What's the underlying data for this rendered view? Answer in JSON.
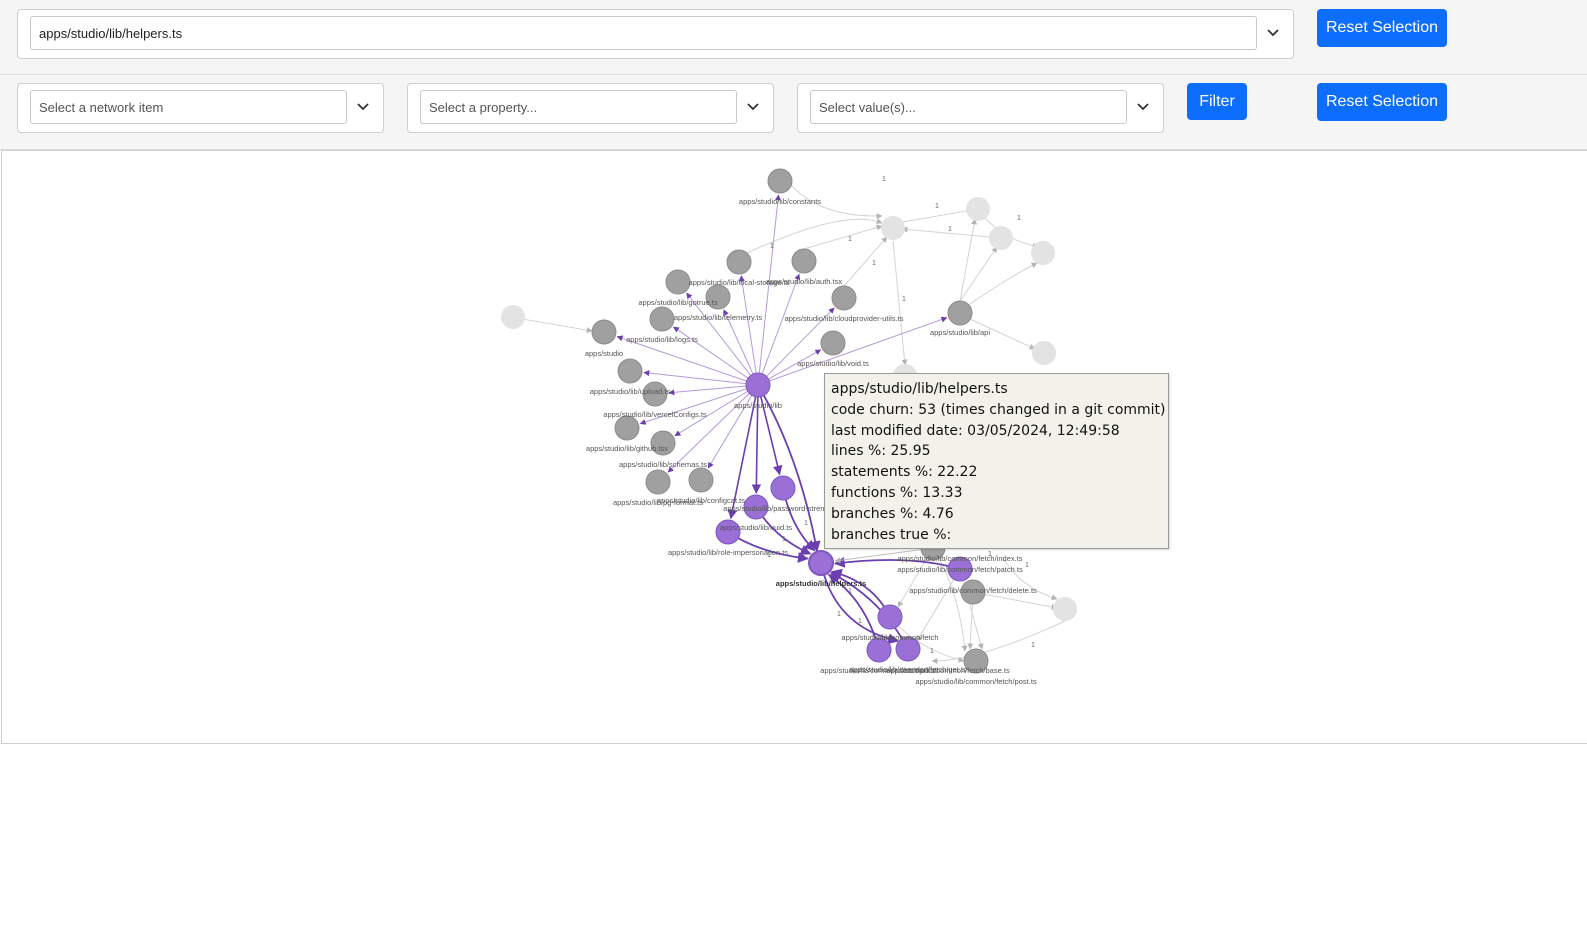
{
  "top_bar": {
    "file_select_value": "apps/studio/lib/helpers.ts",
    "reset_label": "Reset Selection"
  },
  "filter_bar": {
    "network_placeholder": "Select a network item",
    "property_placeholder": "Select a property...",
    "values_placeholder": "Select value(s)...",
    "filter_label": "Filter",
    "reset_label": "Reset Selection"
  },
  "colors": {
    "primary": "#0d6efd",
    "selected_node": "#9a6fd6",
    "neighbor_node": "#a0a0a0",
    "faded_node": "#e3e3e3",
    "selected_edge": "#6b3fb0"
  },
  "graph": {
    "nodes": [
      {
        "label": "apps/studio/lib/constants"
      },
      {
        "label": "apps/studio/lib/local-storage.ts"
      },
      {
        "label": "apps/studio/lib/auth.tsx"
      },
      {
        "label": "apps/studio/lib/gotrue.ts"
      },
      {
        "label": "apps/studio/lib/telemetry.ts"
      },
      {
        "label": "apps/studio/lib/cloudprovider-utils.ts"
      },
      {
        "label": "apps/studio/lib/logs.ts"
      },
      {
        "label": "apps/studio"
      },
      {
        "label": "apps/studio/lib/api"
      },
      {
        "label": "apps/studio/lib/void.ts"
      },
      {
        "label": "apps/studio/lib/upload.ts"
      },
      {
        "label": "apps/studio/lib"
      },
      {
        "label": "apps/studio/lib/vercelConfigs.ts"
      },
      {
        "label": "apps/studio/lib/github.tsx"
      },
      {
        "label": "apps/studio/lib/schemas.ts"
      },
      {
        "label": "apps/studio/lib/pg-format.ts"
      },
      {
        "label": "apps/studio/lib/configcat.ts"
      },
      {
        "label": "apps/studio/lib/password-strength.ts"
      },
      {
        "label": "apps/studio/lib/uuid.ts"
      },
      {
        "label": "apps/studio/lib/role-impersonation.ts"
      },
      {
        "label": "apps/studio/lib/helpers.ts"
      },
      {
        "label": "apps/studio/lib/common/fetch/index.ts"
      },
      {
        "label": "apps/studio/lib/common/fetch/patch.ts"
      },
      {
        "label": "apps/studio/lib/common/fetch/delete.ts"
      },
      {
        "label": "apps/studio/lib/common/fetch"
      },
      {
        "label": "apps/studio/lib/common/fetch/put.ts"
      },
      {
        "label": "apps/studio/lib/common/fetch/get.ts"
      },
      {
        "label": "apps/studio/lib/common/fetch/post.ts"
      },
      {
        "label": "apps/studio/lib/common/fetch/base.ts"
      }
    ],
    "edge_weight_label": "1"
  },
  "tooltip": {
    "title": "apps/studio/lib/helpers.ts",
    "churn": "code churn: 53 (times changed in a git commit)",
    "modified": "last modified date: 03/05/2024, 12:49:58",
    "lines": "lines %: 25.95",
    "statements": "statements %: 22.22",
    "functions": "functions %: 13.33",
    "branches": "branches %: 4.76",
    "branches_true": "branches true %:"
  }
}
